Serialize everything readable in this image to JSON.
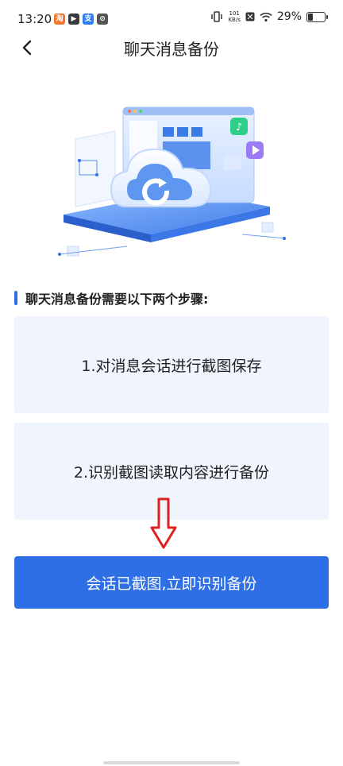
{
  "status_bar": {
    "time": "13:20",
    "app_icons": [
      {
        "name": "app-icon-1",
        "color": "#f5772a",
        "glyph": "淘"
      },
      {
        "name": "app-icon-2",
        "color": "#3a3a3a",
        "glyph": "▶"
      },
      {
        "name": "app-icon-3",
        "color": "#2a7ff5",
        "glyph": "支"
      },
      {
        "name": "app-icon-4",
        "color": "#555555",
        "glyph": "⊘"
      }
    ],
    "net_speed_value": "101",
    "net_speed_unit": "KB/s",
    "battery": "29%"
  },
  "header": {
    "title": "聊天消息备份"
  },
  "section": {
    "heading": "聊天消息备份需要以下两个步骤:"
  },
  "steps": [
    {
      "label": "1.对消息会话进行截图保存"
    },
    {
      "label": "2.识别截图读取内容进行备份"
    }
  ],
  "primary_button": {
    "label": "会话已截图,立即识别备份"
  },
  "colors": {
    "accent": "#2f6fe6",
    "card_bg": "#eff4fd",
    "arrow_red": "#e02020"
  }
}
